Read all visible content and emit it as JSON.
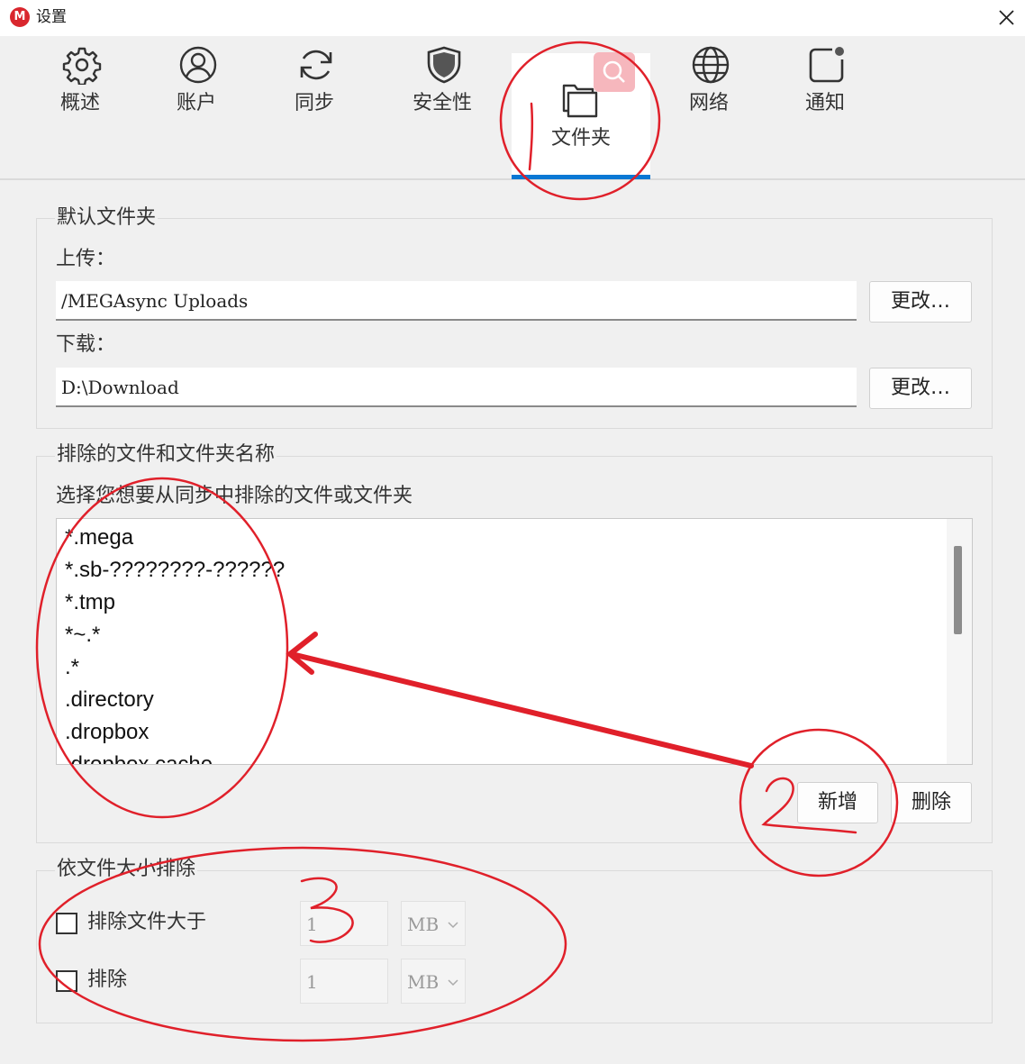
{
  "window": {
    "title": "设置",
    "logo_letter": "M"
  },
  "tabs": [
    {
      "id": "overview",
      "label": "概述",
      "icon": "gear-icon"
    },
    {
      "id": "account",
      "label": "账户",
      "icon": "user-icon"
    },
    {
      "id": "sync",
      "label": "同步",
      "icon": "sync-icon"
    },
    {
      "id": "security",
      "label": "安全性",
      "icon": "shield-icon"
    },
    {
      "id": "folders",
      "label": "文件夹",
      "icon": "folder-icon",
      "active": true
    },
    {
      "id": "network",
      "label": "网络",
      "icon": "globe-icon"
    },
    {
      "id": "notifications",
      "label": "通知",
      "icon": "notification-icon"
    }
  ],
  "default_folders": {
    "title": "默认文件夹",
    "upload_label": "上传：",
    "upload_path": "/MEGAsync Uploads",
    "download_label": "下载：",
    "download_path": "D:\\Download",
    "change_label": "更改…"
  },
  "excluded_names": {
    "title": "排除的文件和文件夹名称",
    "description": "选择您想要从同步中排除的文件或文件夹",
    "items": [
      "*.mega",
      "*.sb-????????-??????",
      "*.tmp",
      "*~.*",
      ".*",
      ".directory",
      ".dropbox",
      ".dropbox.cache"
    ],
    "add_label": "新增",
    "delete_label": "删除"
  },
  "size_exclusion": {
    "title": "依文件大小排除",
    "rows": [
      {
        "label": "排除文件大于",
        "value": "1",
        "unit": "MB",
        "checked": false
      },
      {
        "label": "排除",
        "value": "1",
        "unit": "MB",
        "checked": false
      }
    ]
  },
  "annotations": {
    "color": "#e0202a",
    "marks": [
      "1",
      "2",
      "3"
    ]
  },
  "colors": {
    "accent": "#0a78d4",
    "brand": "#d9272e"
  }
}
